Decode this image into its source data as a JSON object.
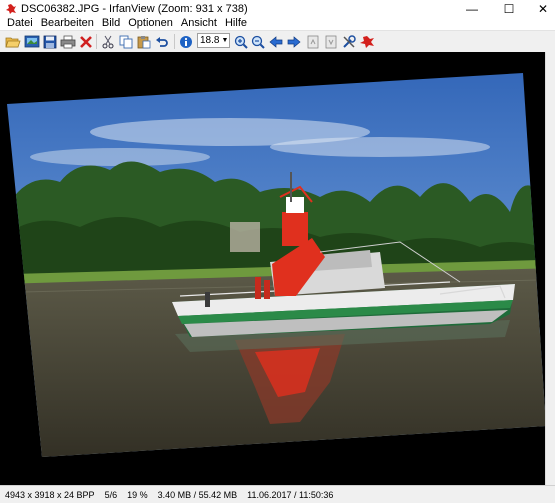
{
  "window": {
    "title": "DSC06382.JPG - IrfanView (Zoom: 931 x 738)",
    "minimize": "—",
    "maximize": "☐",
    "close": "✕"
  },
  "menu": {
    "items": [
      "Datei",
      "Bearbeiten",
      "Bild",
      "Optionen",
      "Ansicht",
      "Hilfe"
    ]
  },
  "toolbar": {
    "zoom_value": "18.8",
    "icons": [
      "open-folder-icon",
      "slideshow-icon",
      "save-icon",
      "print-icon",
      "delete-icon",
      "cut-icon",
      "copy-icon",
      "paste-icon",
      "undo-icon",
      "info-icon",
      "zoom-in-icon",
      "zoom-out-icon",
      "previous-icon",
      "next-icon",
      "first-page-icon",
      "last-page-icon",
      "settings-icon",
      "irfanview-logo-icon"
    ]
  },
  "status": {
    "dimensions": "4943 x 3918 x 24 BPP",
    "index": "5/6",
    "zoom": "19 %",
    "size": "3.40 MB / 55.42 MB",
    "datetime": "11.06.2017 / 11:50:36"
  },
  "colors": {
    "toolbar_bg": "#f0f0f0",
    "viewer_bg": "#000000",
    "sky": "#4a7fc4",
    "water": "#4a4436",
    "boat_red": "#e0301e"
  }
}
